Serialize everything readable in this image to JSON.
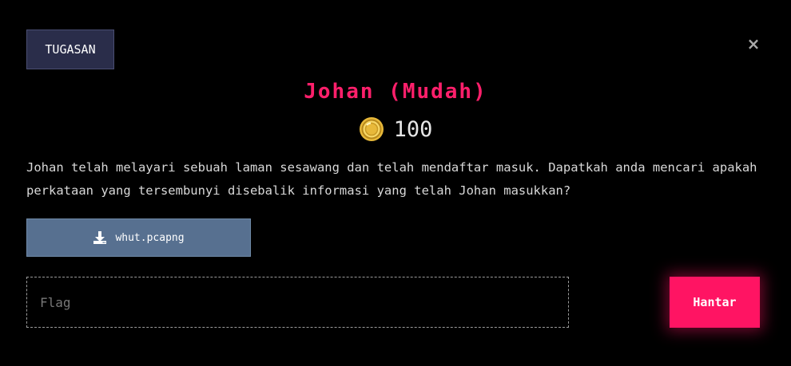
{
  "tab": {
    "label": "TUGASAN"
  },
  "close": {
    "symbol": "×"
  },
  "challenge": {
    "title": "Johan (Mudah)",
    "points": "100",
    "description": "Johan telah melayari sebuah laman sesawang dan telah mendaftar masuk. Dapatkah anda mencari apakah perkataan yang tersembunyi disebalik informasi yang telah Johan masukkan?"
  },
  "attachment": {
    "filename": "whut.pcapng",
    "icon": "download-icon"
  },
  "flag_input": {
    "placeholder": "Flag",
    "value": ""
  },
  "submit": {
    "label": "Hantar"
  },
  "colors": {
    "background": "#000000",
    "title": "#ff1f6b",
    "submit": "#ff1463",
    "download_button": "#577090",
    "tab_button": "#2a2d4a",
    "coin": "#e8b93a"
  }
}
